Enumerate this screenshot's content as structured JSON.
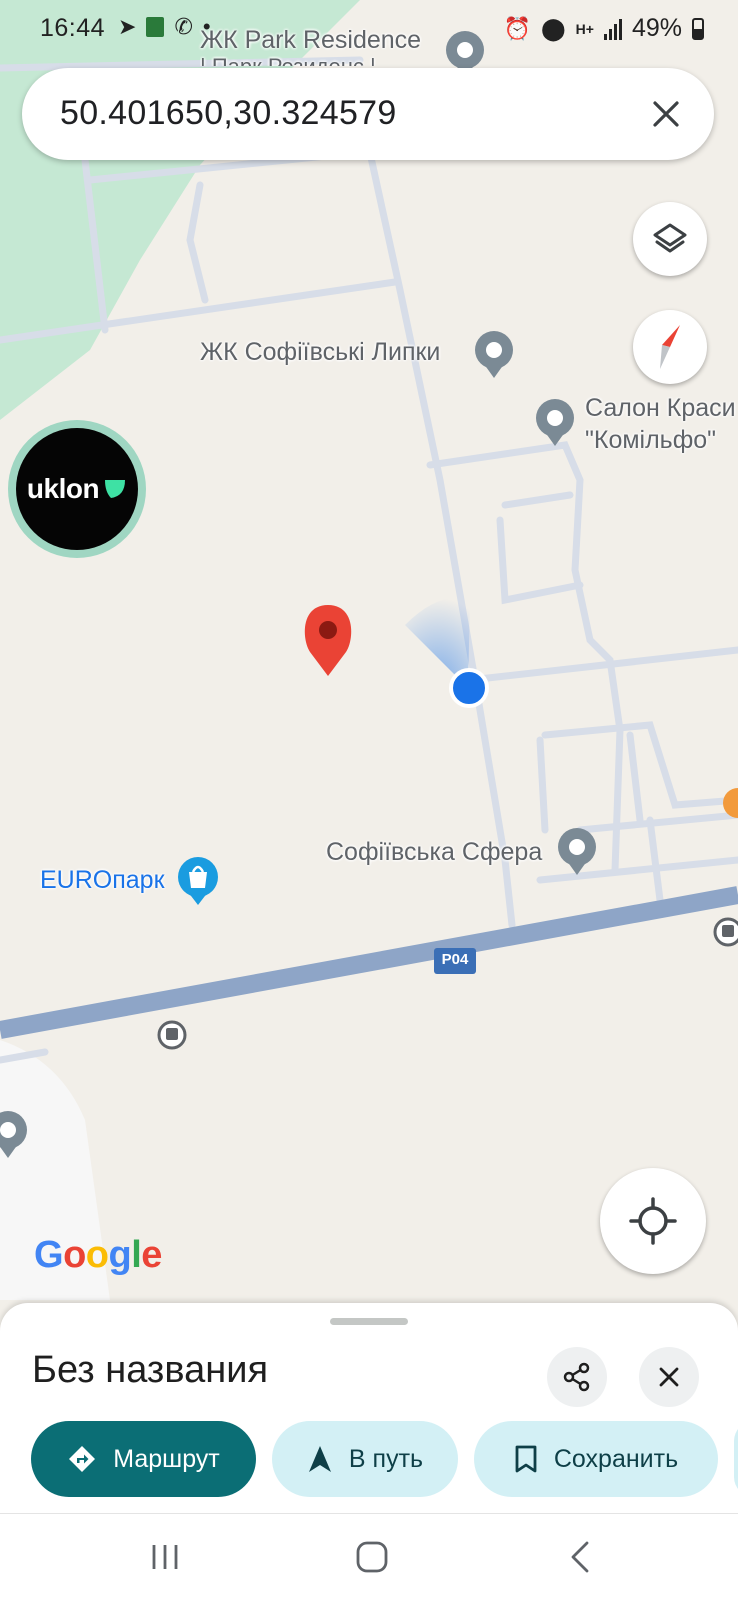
{
  "status_bar": {
    "time": "16:44",
    "battery": "49%",
    "network": "H+",
    "left_icons": [
      "telegram-icon",
      "app-icon",
      "viber-icon",
      "dot-icon"
    ],
    "right_icons": [
      "alarm-icon",
      "location-icon",
      "network-icon",
      "signal-icon",
      "battery-icon"
    ]
  },
  "search": {
    "value": "50.401650,30.324579"
  },
  "map": {
    "pois": [
      {
        "label": "ЖК Park Residence",
        "icon": "place-icon"
      },
      {
        "label": "| Парк Резиденс |",
        "icon": ""
      },
      {
        "label": "ЖК Софіївські Липки",
        "icon": "place-icon"
      },
      {
        "label": "Салон Краси",
        "icon": "place-icon"
      },
      {
        "label": "\"Комільфо\"",
        "icon": ""
      },
      {
        "label": "Софіївська Сфера",
        "icon": "place-icon"
      },
      {
        "label": "EUROпарк",
        "icon": "shopping-bag-icon"
      }
    ],
    "road_label": "P04",
    "logo": "Google",
    "colors": {
      "land": "#f2efe9",
      "park": "#c5e8d3",
      "road": "#dfe3ec",
      "highway": "#8ea5c7",
      "pin": "#ea4335",
      "location_dot": "#1a73e8"
    }
  },
  "uklon": {
    "label": "uklon"
  },
  "sheet": {
    "title": "Без названия",
    "actions": [
      {
        "label": "Маршрут",
        "icon": "directions-icon"
      },
      {
        "label": "В путь",
        "icon": "navigation-arrow-icon"
      },
      {
        "label": "Сохранить",
        "icon": "bookmark-icon"
      }
    ]
  },
  "nav_bar": {
    "buttons": [
      "recent-apps-icon",
      "home-icon",
      "back-icon"
    ]
  }
}
